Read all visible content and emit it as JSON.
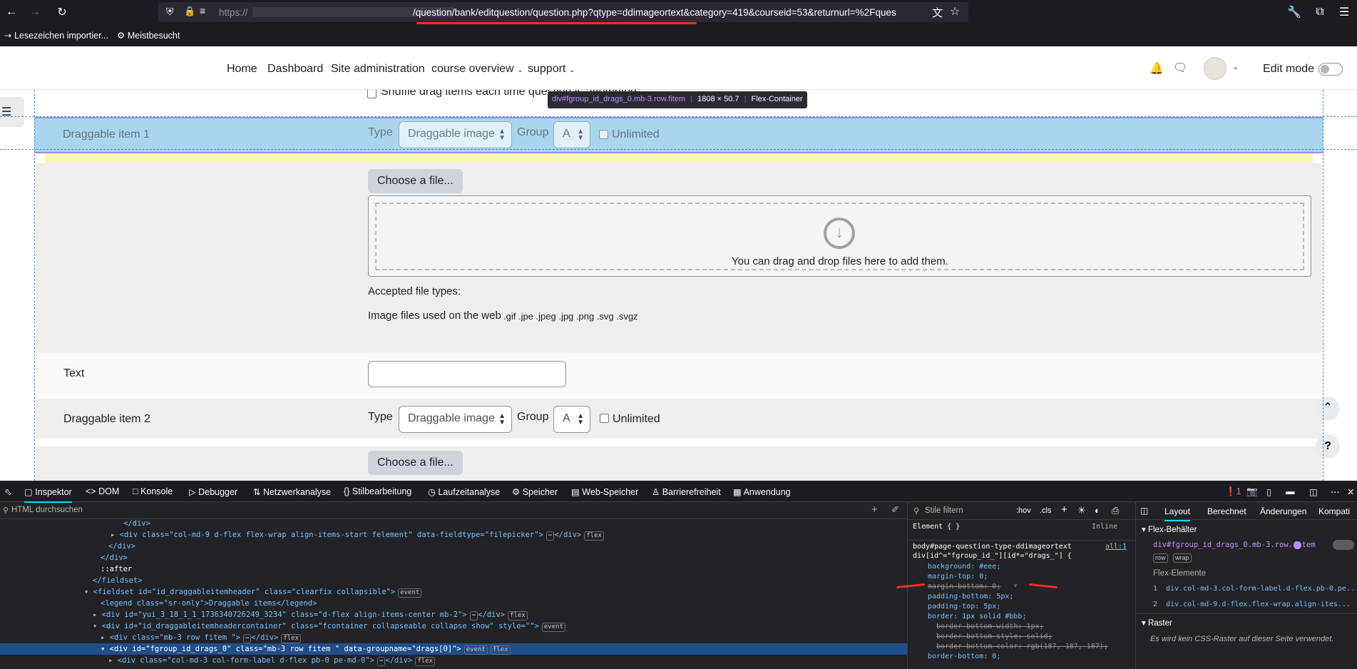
{
  "browser": {
    "url_host": "https://",
    "url_path": "/question/bank/editquestion/question.php?qtype=ddimageortext&category=419&courseid=53&returnurl=%2Fques",
    "bookmarks": [
      "Lesezeichen importier...",
      "Meistbesucht"
    ]
  },
  "site_nav": {
    "items": [
      "Home",
      "Dashboard",
      "Site administration",
      "course overview",
      "support"
    ],
    "edit_mode_label": "Edit mode"
  },
  "inspector_tooltip": {
    "selector": "div#fgroup_id_drags_0.mb-3.row.fitem",
    "size": "1808 × 50.7",
    "kind": "Flex-Container"
  },
  "form": {
    "shuffle_label": "Shuffle drag items each time question is attempted",
    "item1": {
      "label": "Draggable item 1",
      "type_label": "Type",
      "type_value": "Draggable image",
      "group_label": "Group",
      "group_value": "A",
      "unlimited_label": "Unlimited"
    },
    "choose_file": "Choose a file...",
    "dropzone_text": "You can drag and drop files here to add them.",
    "accepted_label": "Accepted file types:",
    "accepted_desc": "Image files used on the web",
    "accepted_ext": ".gif .jpe .jpeg .jpg .png .svg .svgz",
    "text_label": "Text",
    "item2": {
      "label": "Draggable item 2",
      "type_label": "Type",
      "type_value": "Draggable image",
      "group_label": "Group",
      "group_value": "A",
      "unlimited_label": "Unlimited"
    },
    "choose_file2": "Choose a file..."
  },
  "devtools": {
    "tabs": [
      "Inspektor",
      "DOM",
      "Konsole",
      "Debugger",
      "Netzwerkanalyse",
      "Stilbearbeitung",
      "Laufzeitanalyse",
      "Speicher",
      "Web-Speicher",
      "Barrierefreiheit",
      "Anwendung"
    ],
    "search_placeholder": "HTML durchsuchen",
    "error_count": "1",
    "html_lines": [
      "</div>",
      "<div class=\"col-md-9 d-flex flex-wrap align-items-start felement\" data-fieldtype=\"filepicker\">",
      "</div>",
      "</div>",
      "::after",
      "</fieldset>",
      "<fieldset id=\"id_draggableitemheader\" class=\"clearfix collapsible\">",
      "<legend class=\"sr-only\">Draggable items</legend>",
      "<div id=\"yui_3_18_1_1_1736340726249_3234\" class=\"d-flex align-items-center mb-2\">",
      "<div id=\"id_draggableitemheadercontainer\" class=\"fcontainer collapseable collapse show\" style=\"\">",
      "<div class=\"mb-3 row fitem \">",
      "<div id=\"fgroup_id_drags_0\" class=\"mb-3 row fitem \" data-groupname=\"drags[0]\">",
      "<div class=\"col-md-3 col-form-label d-flex pb-0 pe-md-0\">"
    ],
    "badges": {
      "flex": "flex",
      "event": "event",
      "dots": "⋯"
    },
    "styles": {
      "filter_placeholder": "Stile filtern",
      "pseudo": ":hov",
      "cls": ".cls",
      "element_rule": "Element { }",
      "inline": "Inline",
      "selector1": "body#page-question-type-ddimageortext",
      "selector2": "div[id^=\"fgroup_id_\"][id*=\"drags_\"] { ",
      "source": "all:1",
      "decls": [
        "background: #eee;",
        "margin-top: 0;",
        "margin-bottom: 0;",
        "padding-bottom: 5px;",
        "padding-top: 5px;",
        "border: 1px solid #bbb;",
        "border-bottom-width: 1px;",
        "border-bottom-style: solid;",
        "border-bottom-color: rgb(187, 187, 187);",
        "border-bottom: 0;"
      ]
    },
    "layout": {
      "tabs": [
        "Layout",
        "Berechnet",
        "Änderungen",
        "Kompati"
      ],
      "flex_container_title": "Flex-Behälter",
      "flex_container_item": "div#fgroup_id_drags_0.mb-3.row.fitem",
      "chips": [
        "row",
        "wrap"
      ],
      "flex_items_title": "Flex-Elemente",
      "flex_items": [
        "div.col-md-3.col-form-label.d-flex.pb-0.pe...",
        "div.col-md-9.d-flex.flex-wrap.align-ites..."
      ],
      "grid_title": "Raster",
      "grid_text": "Es wird kein CSS-Raster auf dieser Seite verwendet."
    }
  },
  "colors": {
    "highlight": "#a9d6ee",
    "row_bg": "#eee",
    "annotation": "#e8321e"
  }
}
